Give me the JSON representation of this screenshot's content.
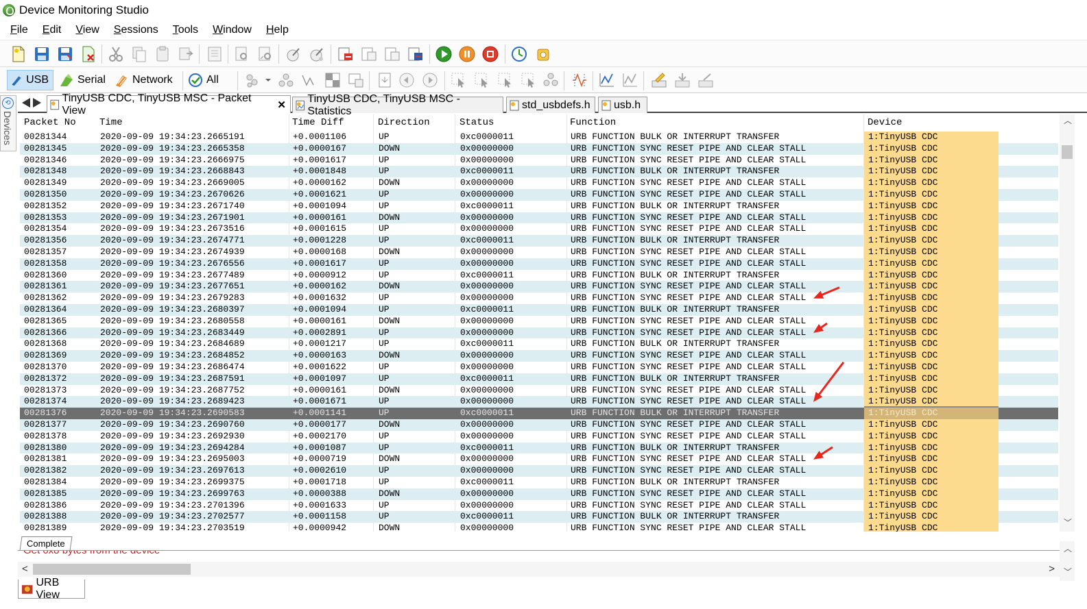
{
  "window": {
    "title": "Device Monitoring Studio"
  },
  "menu": [
    {
      "pre": "",
      "ul": "F",
      "post": "ile"
    },
    {
      "pre": "",
      "ul": "E",
      "post": "dit"
    },
    {
      "pre": "",
      "ul": "V",
      "post": "iew"
    },
    {
      "pre": "",
      "ul": "S",
      "post": "essions"
    },
    {
      "pre": "",
      "ul": "T",
      "post": "ools"
    },
    {
      "pre": "",
      "ul": "W",
      "post": "indow"
    },
    {
      "pre": "",
      "ul": "H",
      "post": "elp"
    }
  ],
  "sources": {
    "usb": "USB",
    "serial": "Serial",
    "network": "Network",
    "all": "All"
  },
  "side": {
    "label": "Devices"
  },
  "tabs": [
    {
      "label": "TinyUSB CDC, TinyUSB MSC - Packet View",
      "close": "✕"
    },
    {
      "label": "TinyUSB CDC, TinyUSB MSC - Statistics"
    },
    {
      "label": "std_usbdefs.h"
    },
    {
      "label": "usb.h"
    }
  ],
  "columns": [
    "Packet No",
    "Time",
    "Time Diff",
    "Direction",
    "Status",
    "Function",
    "Device"
  ],
  "rows": [
    [
      "00281344",
      "2020-09-09 19:34:23.2665191",
      "+0.0001106",
      "UP",
      "0xc0000011",
      "URB FUNCTION BULK OR INTERRUPT TRANSFER",
      "1:TinyUSB CDC"
    ],
    [
      "00281345",
      "2020-09-09 19:34:23.2665358",
      "+0.0000167",
      "DOWN",
      "0x00000000",
      "URB FUNCTION SYNC RESET PIPE AND CLEAR STALL",
      "1:TinyUSB CDC"
    ],
    [
      "00281346",
      "2020-09-09 19:34:23.2666975",
      "+0.0001617",
      "UP",
      "0x00000000",
      "URB FUNCTION SYNC RESET PIPE AND CLEAR STALL",
      "1:TinyUSB CDC"
    ],
    [
      "00281348",
      "2020-09-09 19:34:23.2668843",
      "+0.0001848",
      "UP",
      "0xc0000011",
      "URB FUNCTION BULK OR INTERRUPT TRANSFER",
      "1:TinyUSB CDC"
    ],
    [
      "00281349",
      "2020-09-09 19:34:23.2669005",
      "+0.0000162",
      "DOWN",
      "0x00000000",
      "URB FUNCTION SYNC RESET PIPE AND CLEAR STALL",
      "1:TinyUSB CDC"
    ],
    [
      "00281350",
      "2020-09-09 19:34:23.2670626",
      "+0.0001621",
      "UP",
      "0x00000000",
      "URB FUNCTION SYNC RESET PIPE AND CLEAR STALL",
      "1:TinyUSB CDC"
    ],
    [
      "00281352",
      "2020-09-09 19:34:23.2671740",
      "+0.0001094",
      "UP",
      "0xc0000011",
      "URB FUNCTION BULK OR INTERRUPT TRANSFER",
      "1:TinyUSB CDC"
    ],
    [
      "00281353",
      "2020-09-09 19:34:23.2671901",
      "+0.0000161",
      "DOWN",
      "0x00000000",
      "URB FUNCTION SYNC RESET PIPE AND CLEAR STALL",
      "1:TinyUSB CDC"
    ],
    [
      "00281354",
      "2020-09-09 19:34:23.2673516",
      "+0.0001615",
      "UP",
      "0x00000000",
      "URB FUNCTION SYNC RESET PIPE AND CLEAR STALL",
      "1:TinyUSB CDC"
    ],
    [
      "00281356",
      "2020-09-09 19:34:23.2674771",
      "+0.0001228",
      "UP",
      "0xc0000011",
      "URB FUNCTION BULK OR INTERRUPT TRANSFER",
      "1:TinyUSB CDC"
    ],
    [
      "00281357",
      "2020-09-09 19:34:23.2674939",
      "+0.0000168",
      "DOWN",
      "0x00000000",
      "URB FUNCTION SYNC RESET PIPE AND CLEAR STALL",
      "1:TinyUSB CDC"
    ],
    [
      "00281358",
      "2020-09-09 19:34:23.2676556",
      "+0.0001617",
      "UP",
      "0x00000000",
      "URB FUNCTION SYNC RESET PIPE AND CLEAR STALL",
      "1:TinyUSB CDC"
    ],
    [
      "00281360",
      "2020-09-09 19:34:23.2677489",
      "+0.0000912",
      "UP",
      "0xc0000011",
      "URB FUNCTION BULK OR INTERRUPT TRANSFER",
      "1:TinyUSB CDC"
    ],
    [
      "00281361",
      "2020-09-09 19:34:23.2677651",
      "+0.0000162",
      "DOWN",
      "0x00000000",
      "URB FUNCTION SYNC RESET PIPE AND CLEAR STALL",
      "1:TinyUSB CDC"
    ],
    [
      "00281362",
      "2020-09-09 19:34:23.2679283",
      "+0.0001632",
      "UP",
      "0x00000000",
      "URB FUNCTION SYNC RESET PIPE AND CLEAR STALL",
      "1:TinyUSB CDC"
    ],
    [
      "00281364",
      "2020-09-09 19:34:23.2680397",
      "+0.0001094",
      "UP",
      "0xc0000011",
      "URB FUNCTION BULK OR INTERRUPT TRANSFER",
      "1:TinyUSB CDC"
    ],
    [
      "00281365",
      "2020-09-09 19:34:23.2680558",
      "+0.0000161",
      "DOWN",
      "0x00000000",
      "URB FUNCTION SYNC RESET PIPE AND CLEAR STALL",
      "1:TinyUSB CDC"
    ],
    [
      "00281366",
      "2020-09-09 19:34:23.2683449",
      "+0.0002891",
      "UP",
      "0x00000000",
      "URB FUNCTION SYNC RESET PIPE AND CLEAR STALL",
      "1:TinyUSB CDC"
    ],
    [
      "00281368",
      "2020-09-09 19:34:23.2684689",
      "+0.0001217",
      "UP",
      "0xc0000011",
      "URB FUNCTION BULK OR INTERRUPT TRANSFER",
      "1:TinyUSB CDC"
    ],
    [
      "00281369",
      "2020-09-09 19:34:23.2684852",
      "+0.0000163",
      "DOWN",
      "0x00000000",
      "URB FUNCTION SYNC RESET PIPE AND CLEAR STALL",
      "1:TinyUSB CDC"
    ],
    [
      "00281370",
      "2020-09-09 19:34:23.2686474",
      "+0.0001622",
      "UP",
      "0x00000000",
      "URB FUNCTION SYNC RESET PIPE AND CLEAR STALL",
      "1:TinyUSB CDC"
    ],
    [
      "00281372",
      "2020-09-09 19:34:23.2687591",
      "+0.0001097",
      "UP",
      "0xc0000011",
      "URB FUNCTION BULK OR INTERRUPT TRANSFER",
      "1:TinyUSB CDC"
    ],
    [
      "00281373",
      "2020-09-09 19:34:23.2687752",
      "+0.0000161",
      "DOWN",
      "0x00000000",
      "URB FUNCTION SYNC RESET PIPE AND CLEAR STALL",
      "1:TinyUSB CDC"
    ],
    [
      "00281374",
      "2020-09-09 19:34:23.2689423",
      "+0.0001671",
      "UP",
      "0x00000000",
      "URB FUNCTION SYNC RESET PIPE AND CLEAR STALL",
      "1:TinyUSB CDC"
    ],
    [
      "00281376",
      "2020-09-09 19:34:23.2690583",
      "+0.0001141",
      "UP",
      "0xc0000011",
      "URB FUNCTION BULK OR INTERRUPT TRANSFER",
      "1:TinyUSB CDC"
    ],
    [
      "00281377",
      "2020-09-09 19:34:23.2690760",
      "+0.0000177",
      "DOWN",
      "0x00000000",
      "URB FUNCTION SYNC RESET PIPE AND CLEAR STALL",
      "1:TinyUSB CDC"
    ],
    [
      "00281378",
      "2020-09-09 19:34:23.2692930",
      "+0.0002170",
      "UP",
      "0x00000000",
      "URB FUNCTION SYNC RESET PIPE AND CLEAR STALL",
      "1:TinyUSB CDC"
    ],
    [
      "00281380",
      "2020-09-09 19:34:23.2694284",
      "+0.0001087",
      "UP",
      "0xc0000011",
      "URB FUNCTION BULK OR INTERRUPT TRANSFER",
      "1:TinyUSB CDC"
    ],
    [
      "00281381",
      "2020-09-09 19:34:23.2695003",
      "+0.0000719",
      "DOWN",
      "0x00000000",
      "URB FUNCTION SYNC RESET PIPE AND CLEAR STALL",
      "1:TinyUSB CDC"
    ],
    [
      "00281382",
      "2020-09-09 19:34:23.2697613",
      "+0.0002610",
      "UP",
      "0x00000000",
      "URB FUNCTION SYNC RESET PIPE AND CLEAR STALL",
      "1:TinyUSB CDC"
    ],
    [
      "00281384",
      "2020-09-09 19:34:23.2699375",
      "+0.0001718",
      "UP",
      "0xc0000011",
      "URB FUNCTION BULK OR INTERRUPT TRANSFER",
      "1:TinyUSB CDC"
    ],
    [
      "00281385",
      "2020-09-09 19:34:23.2699763",
      "+0.0000388",
      "DOWN",
      "0x00000000",
      "URB FUNCTION SYNC RESET PIPE AND CLEAR STALL",
      "1:TinyUSB CDC"
    ],
    [
      "00281386",
      "2020-09-09 19:34:23.2701396",
      "+0.0001633",
      "UP",
      "0x00000000",
      "URB FUNCTION SYNC RESET PIPE AND CLEAR STALL",
      "1:TinyUSB CDC"
    ],
    [
      "00281388",
      "2020-09-09 19:34:23.2702577",
      "+0.0001158",
      "UP",
      "0xc0000011",
      "URB FUNCTION BULK OR INTERRUPT TRANSFER",
      "1:TinyUSB CDC"
    ],
    [
      "00281389",
      "2020-09-09 19:34:23.2703519",
      "+0.0000942",
      "DOWN",
      "0x00000000",
      "URB FUNCTION SYNC RESET PIPE AND CLEAR STALL",
      "1:TinyUSB CDC"
    ]
  ],
  "selected_row_index": 24,
  "annotation_arrow_rows": [
    14,
    17,
    23,
    28
  ],
  "colors": {
    "row_alt": "#dceef2",
    "row_selected": "#6e6e6e",
    "device_cell": "#fcdb8e",
    "annotation_arrow": "#e8261d",
    "message_text": "#cc1f1f"
  },
  "bottom": {
    "tab_label": "Complete",
    "message": "Get 0x8 bytes from the device"
  },
  "urb_tab": {
    "label": "URB View"
  }
}
